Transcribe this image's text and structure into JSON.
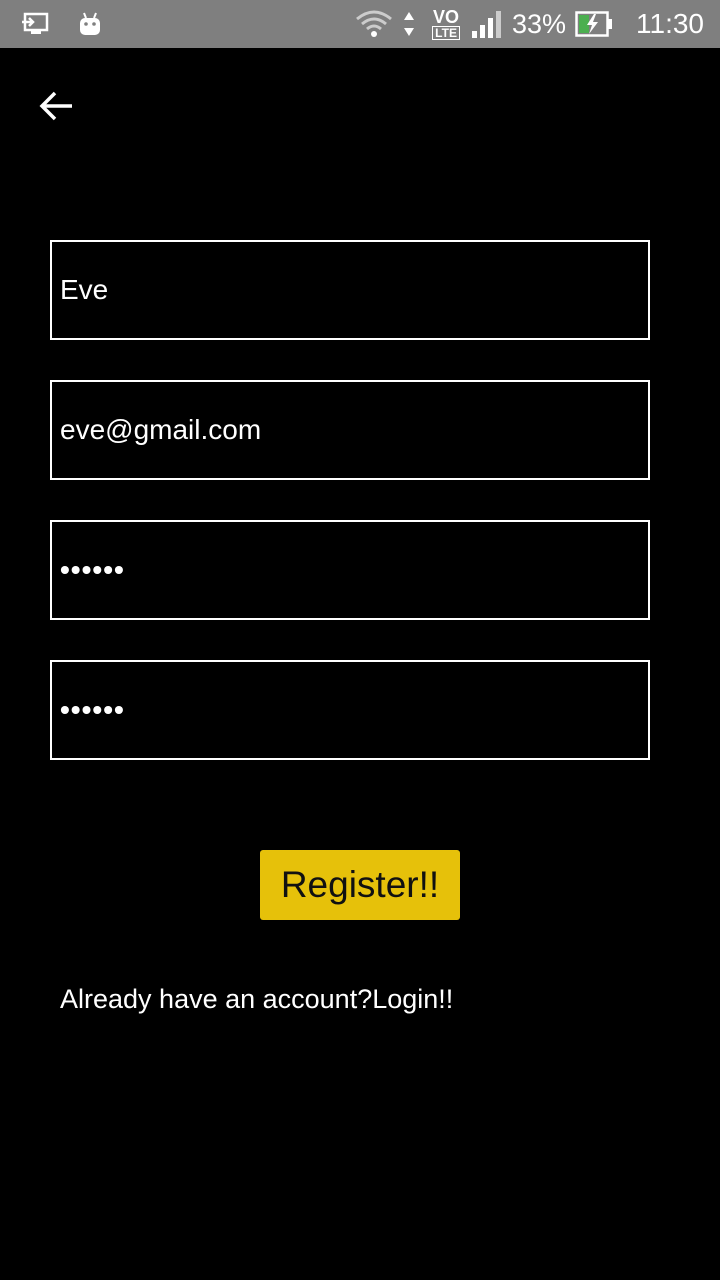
{
  "status_bar": {
    "network_label": "VO",
    "lte_label": "LTE",
    "battery": "33%",
    "time": "11:30"
  },
  "form": {
    "name_value": "Eve",
    "email_value": "eve@gmail.com",
    "password_value": "••••••",
    "confirm_password_value": "••••••"
  },
  "actions": {
    "register_label": "Register!!",
    "login_link": "Already have an account?Login!!"
  }
}
